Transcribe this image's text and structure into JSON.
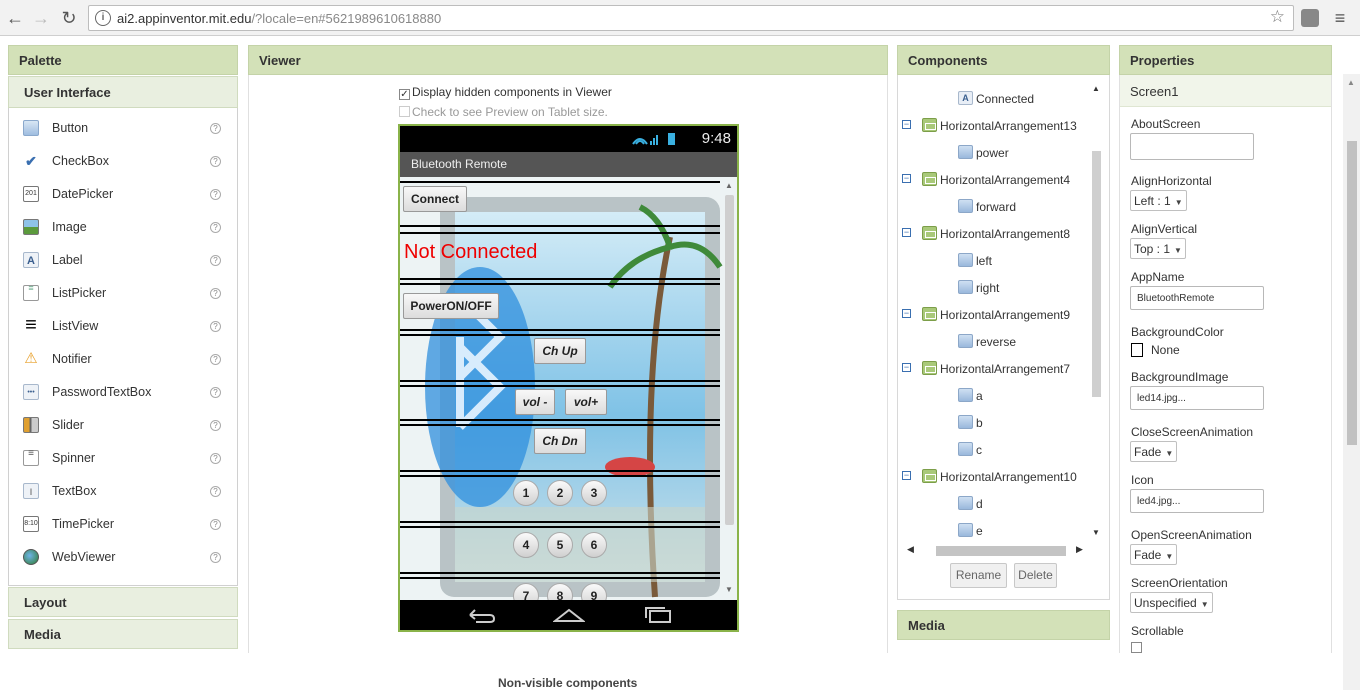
{
  "browser": {
    "url_host": "ai2.appinventor.mit.edu",
    "url_path": "/?locale=en#5621989610618880"
  },
  "palette": {
    "title": "Palette",
    "section_ui": "User Interface",
    "items": [
      {
        "label": "Button",
        "icon": "button-icon"
      },
      {
        "label": "CheckBox",
        "icon": "checkbox-icon"
      },
      {
        "label": "DatePicker",
        "icon": "datepicker-icon"
      },
      {
        "label": "Image",
        "icon": "image-icon"
      },
      {
        "label": "Label",
        "icon": "label-icon"
      },
      {
        "label": "ListPicker",
        "icon": "listpicker-icon"
      },
      {
        "label": "ListView",
        "icon": "listview-icon"
      },
      {
        "label": "Notifier",
        "icon": "notifier-icon"
      },
      {
        "label": "PasswordTextBox",
        "icon": "password-icon"
      },
      {
        "label": "Slider",
        "icon": "slider-icon"
      },
      {
        "label": "Spinner",
        "icon": "spinner-icon"
      },
      {
        "label": "TextBox",
        "icon": "textbox-icon"
      },
      {
        "label": "TimePicker",
        "icon": "timepicker-icon"
      },
      {
        "label": "WebViewer",
        "icon": "webviewer-icon"
      }
    ],
    "help_glyph": "?",
    "section_layout": "Layout",
    "section_media": "Media"
  },
  "viewer": {
    "title": "Viewer",
    "display_hidden": "Display hidden components in Viewer",
    "tablet_preview": "Check to see Preview on Tablet size.",
    "status_time": "9:48",
    "app_title": "Bluetooth Remote",
    "connect_label": "Connect",
    "status_text": "Not Connected",
    "power_label": "PowerON/OFF",
    "chup_label": "Ch Up",
    "volminus_label": "vol -",
    "volplus_label": "vol+",
    "chdn_label": "Ch Dn",
    "numbers": [
      "1",
      "2",
      "3",
      "4",
      "5",
      "6",
      "7",
      "8",
      "9"
    ],
    "nonvisible": "Non-visible components"
  },
  "components": {
    "title": "Components",
    "tree": [
      {
        "label": "Connected",
        "type": "label",
        "level": 2
      },
      {
        "label": "HorizontalArrangement13",
        "type": "arrangement",
        "level": 1
      },
      {
        "label": "power",
        "type": "button",
        "level": 2
      },
      {
        "label": "HorizontalArrangement4",
        "type": "arrangement",
        "level": 1
      },
      {
        "label": "forward",
        "type": "button",
        "level": 2
      },
      {
        "label": "HorizontalArrangement8",
        "type": "arrangement",
        "level": 1
      },
      {
        "label": "left",
        "type": "button",
        "level": 2
      },
      {
        "label": "right",
        "type": "button",
        "level": 2
      },
      {
        "label": "HorizontalArrangement9",
        "type": "arrangement",
        "level": 1
      },
      {
        "label": "reverse",
        "type": "button",
        "level": 2
      },
      {
        "label": "HorizontalArrangement7",
        "type": "arrangement",
        "level": 1
      },
      {
        "label": "a",
        "type": "button",
        "level": 2
      },
      {
        "label": "b",
        "type": "button",
        "level": 2
      },
      {
        "label": "c",
        "type": "button",
        "level": 2
      },
      {
        "label": "HorizontalArrangement10",
        "type": "arrangement",
        "level": 1
      },
      {
        "label": "d",
        "type": "button",
        "level": 2
      },
      {
        "label": "e",
        "type": "button",
        "level": 2
      }
    ],
    "rename_label": "Rename",
    "delete_label": "Delete",
    "media_title": "Media"
  },
  "properties": {
    "title": "Properties",
    "screen_name": "Screen1",
    "about_label": "AboutScreen",
    "about_value": "",
    "align_h_label": "AlignHorizontal",
    "align_h_value": "Left : 1",
    "align_v_label": "AlignVertical",
    "align_v_value": "Top : 1",
    "appname_label": "AppName",
    "appname_value": "BluetoothRemote",
    "bgcolor_label": "BackgroundColor",
    "bgcolor_value": "None",
    "bgimage_label": "BackgroundImage",
    "bgimage_value": "led14.jpg...",
    "close_anim_label": "CloseScreenAnimation",
    "close_anim_value": "Fade",
    "icon_label": "Icon",
    "icon_value": "led4.jpg...",
    "open_anim_label": "OpenScreenAnimation",
    "open_anim_value": "Fade",
    "orientation_label": "ScreenOrientation",
    "orientation_value": "Unspecified",
    "scrollable_label": "Scrollable"
  }
}
